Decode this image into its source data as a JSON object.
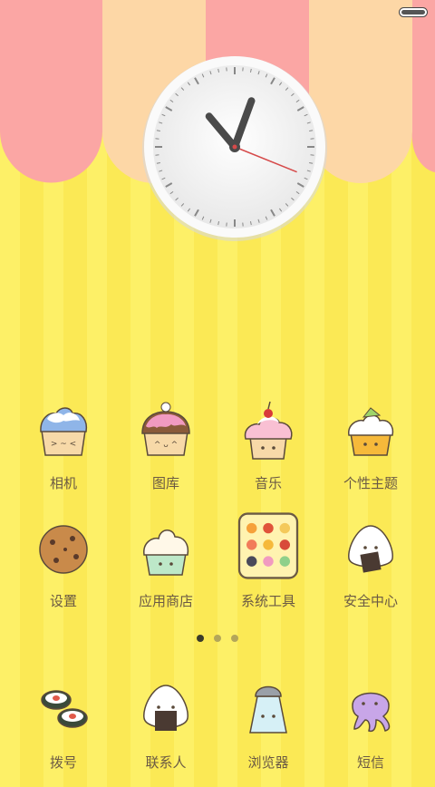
{
  "status": {
    "battery_icon": "battery-icon"
  },
  "clock": {
    "hour_hand_deg": 320,
    "minute_hand_deg": 20,
    "second_hand_deg": 112
  },
  "apps": [
    {
      "label": "相机",
      "icon": "blue-cupcake-icon"
    },
    {
      "label": "图库",
      "icon": "pink-muffin-icon"
    },
    {
      "label": "音乐",
      "icon": "cherry-cupcake-icon"
    },
    {
      "label": "个性主题",
      "icon": "lime-cupcake-icon"
    },
    {
      "label": "设置",
      "icon": "cookie-icon"
    },
    {
      "label": "应用商店",
      "icon": "mint-cupcake-icon"
    },
    {
      "label": "系统工具",
      "icon": "folder-icon"
    },
    {
      "label": "安全中心",
      "icon": "onigiri-icon"
    }
  ],
  "pager": {
    "pages": 3,
    "current": 1
  },
  "dock": [
    {
      "label": "拨号",
      "icon": "sushi-icon"
    },
    {
      "label": "联系人",
      "icon": "riceball-icon"
    },
    {
      "label": "浏览器",
      "icon": "salt-shaker-icon"
    },
    {
      "label": "短信",
      "icon": "octopus-icon"
    }
  ]
}
